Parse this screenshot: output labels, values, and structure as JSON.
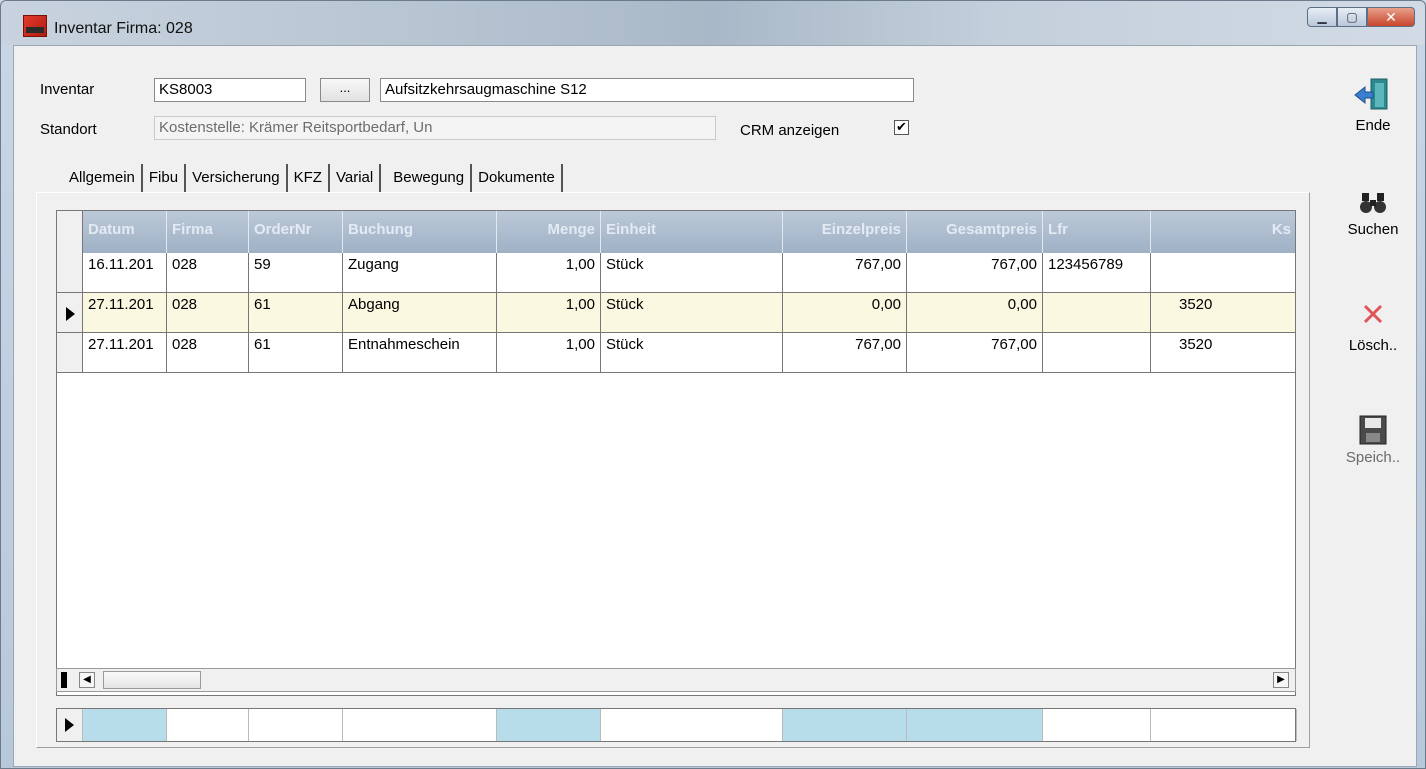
{
  "window": {
    "title": "Inventar Firma: 028",
    "controls": [
      "minimize",
      "maximize",
      "close"
    ]
  },
  "form": {
    "inventar_label": "Inventar",
    "inventar_value": "KS8003",
    "lookup_button": "...",
    "description_value": "Aufsitzkehrsaugmaschine S12",
    "standort_label": "Standort",
    "standort_value": "Kostenstelle: Krämer Reitsportbedarf, Un",
    "crm_label": "CRM anzeigen",
    "crm_checked": "✔"
  },
  "tabs": [
    {
      "label": "Allgemein"
    },
    {
      "label": "Fibu"
    },
    {
      "label": "Versicherung"
    },
    {
      "label": "KFZ"
    },
    {
      "label": "Varial"
    },
    {
      "label": "Bewegung",
      "active": true
    },
    {
      "label": "Dokumente"
    }
  ],
  "grid": {
    "headers": [
      "Datum",
      "Firma",
      "OrderNr",
      "Buchung",
      "Menge",
      "Einheit",
      "Einzelpreis",
      "Gesamtpreis",
      "Lfr",
      "Ks"
    ],
    "rows": [
      [
        "16.11.201",
        "028",
        "59",
        "Zugang",
        "1,00",
        "Stück",
        "767,00",
        "767,00",
        "123456789",
        ""
      ],
      [
        "27.11.201",
        "028",
        "61",
        "Abgang",
        "1,00",
        "Stück",
        "0,00",
        "0,00",
        "",
        "3520"
      ],
      [
        "27.11.201",
        "028",
        "61",
        "Entnahmeschein",
        "1,00",
        "Stück",
        "767,00",
        "767,00",
        "",
        "3520"
      ]
    ],
    "selected_row_index": 1
  },
  "sidebar": {
    "ende": "Ende",
    "suchen": "Suchen",
    "loeschen": "Lösch..",
    "speichern": "Speich.."
  }
}
